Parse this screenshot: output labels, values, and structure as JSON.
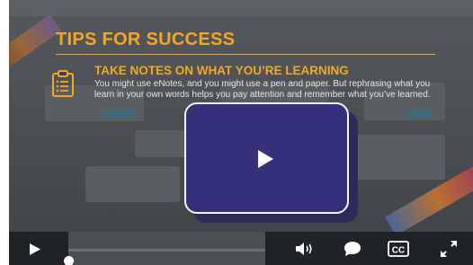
{
  "slide": {
    "title": "TIPS FOR SUCCESS",
    "tip": {
      "heading": "TAKE NOTES ON WHAT YOU’RE LEARNING",
      "body": "You might use eNotes, and you might use a pen and paper. But rephrasing what you learn in your own words helps you pay attention and remember what you’ve learned."
    }
  },
  "colors": {
    "accent": "#f5a623",
    "play_overlay": "#35307a",
    "controls_bg": "#1f2226"
  },
  "icons": {
    "tip": "clipboard-icon",
    "overlay": "play-icon",
    "controls": [
      "play-icon",
      "volume-icon",
      "speech-bubble-icon",
      "closed-captions-icon",
      "fullscreen-icon"
    ]
  },
  "controls": {
    "cc_label": "CC",
    "progress_fraction": 0.0
  }
}
